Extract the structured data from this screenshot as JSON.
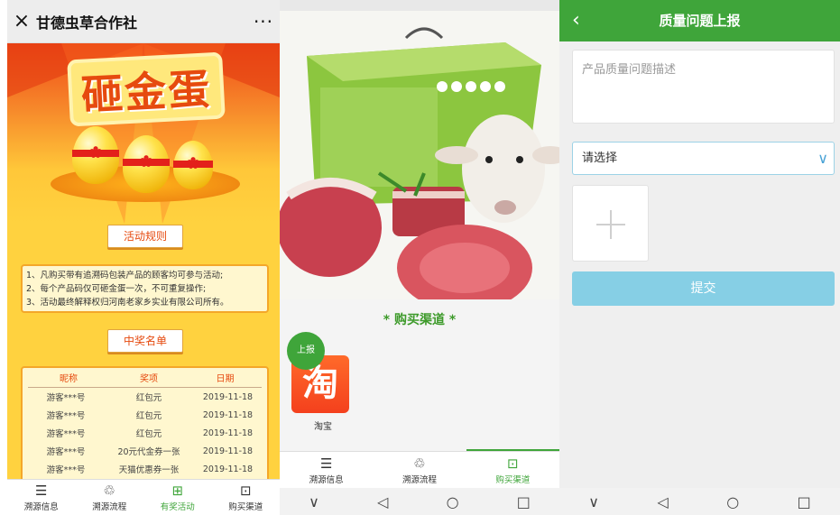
{
  "panel1": {
    "title": "甘德虫草合作社",
    "close_icon": "×",
    "more_icon": "···",
    "headline": "砸金蛋",
    "rules_button": "活动规则",
    "rules": [
      "1、凡购买带有追溯码包装产品的顾客均可参与活动;",
      "2、每个产品码仅可砸金蛋一次，不可重复操作;",
      "3、活动最终解释权归河南老家乡实业有限公司所有。"
    ],
    "winners_button": "中奖名单",
    "table_headers": [
      "昵称",
      "奖项",
      "日期"
    ],
    "table_rows": [
      [
        "游客***号",
        "红包元",
        "2019-11-18"
      ],
      [
        "游客***号",
        "红包元",
        "2019-11-18"
      ],
      [
        "游客***号",
        "红包元",
        "2019-11-18"
      ],
      [
        "游客***号",
        "20元代金券一张",
        "2019-11-18"
      ],
      [
        "游客***号",
        "天猫优惠券一张",
        "2019-11-18"
      ]
    ],
    "tabs": [
      {
        "label": "溯源信息",
        "icon": "☰"
      },
      {
        "label": "溯源流程",
        "icon": "♲"
      },
      {
        "label": "有奖活动",
        "icon": "⊞"
      },
      {
        "label": "购买渠道",
        "icon": "⊡"
      }
    ],
    "active_tab": "有奖活动"
  },
  "panel2": {
    "channel_title": "* 购买渠道 *",
    "report_badge": "上报",
    "taobao_logo": "淘",
    "taobao_label": "淘宝",
    "tabs": [
      {
        "label": "溯源信息",
        "icon": "☰"
      },
      {
        "label": "溯源流程",
        "icon": "♲"
      },
      {
        "label": "购买渠道",
        "icon": "⊡"
      }
    ],
    "active_tab": "购买渠道",
    "nav": [
      "∨",
      "◁",
      "○",
      "□"
    ]
  },
  "panel3": {
    "back_icon": "‹",
    "title": "质量问题上报",
    "description_placeholder": "产品质量问题描述",
    "select_value": "请选择",
    "chevron_icon": "∨",
    "submit_label": "提交",
    "nav": [
      "∨",
      "◁",
      "○",
      "□"
    ]
  },
  "colors": {
    "brand_green": "#3fa53a",
    "submit_blue": "#86cfe5",
    "prize_orange": "#e64a0f"
  }
}
